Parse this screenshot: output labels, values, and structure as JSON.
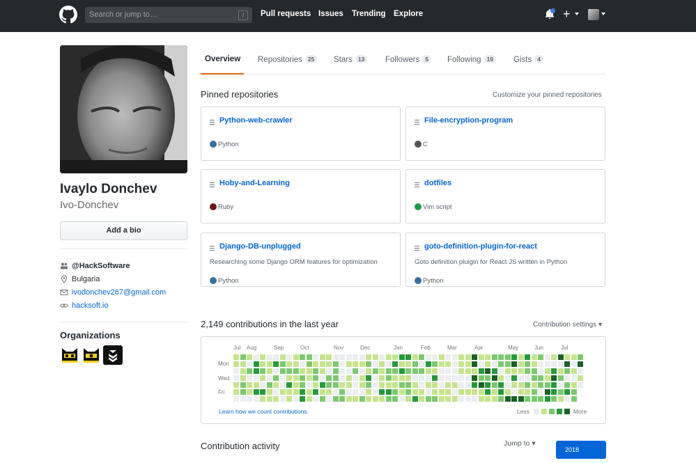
{
  "colors": {
    "header_bg": "#24292e",
    "link": "#0366d6",
    "tab_underline": "#e36209",
    "lang_python": "#3572A5",
    "lang_c": "#555555",
    "lang_ruby": "#701516",
    "lang_vim": "#199f4b",
    "contrib_levels": [
      "#ebedf0",
      "#c6e48b",
      "#7bc96f",
      "#239a3b",
      "#196127"
    ]
  },
  "header": {
    "logo_icon": "github-octocat-icon",
    "search_placeholder": "Search or jump to…",
    "search_shortcut": "/",
    "nav": [
      "Pull requests",
      "Issues",
      "Trending",
      "Explore"
    ],
    "notification_icon": "bell-icon",
    "create_icon": "plus-icon",
    "avatar_icon": "user-avatar-icon"
  },
  "profile": {
    "full_name": "Ivaylo Donchev",
    "username": "Ivo-Donchev",
    "add_bio_label": "Add a bio",
    "details": [
      {
        "icon": "organization-icon",
        "text": "@HackSoftware",
        "bold": true,
        "link": false
      },
      {
        "icon": "location-icon",
        "text": "Bulgaria",
        "bold": false,
        "link": false
      },
      {
        "icon": "mail-icon",
        "text": "ivodonchev267@gmail.com",
        "bold": false,
        "link": true
      },
      {
        "icon": "link-icon",
        "text": "hacksoft.io",
        "bold": false,
        "link": true
      }
    ],
    "organizations_title": "Organizations",
    "organizations": [
      "org-avatar-1",
      "org-avatar-2",
      "org-avatar-3"
    ]
  },
  "tabs": [
    {
      "label": "Overview",
      "count": null,
      "selected": true
    },
    {
      "label": "Repositories",
      "count": "25",
      "selected": false
    },
    {
      "label": "Stars",
      "count": "13",
      "selected": false
    },
    {
      "label": "Followers",
      "count": "5",
      "selected": false
    },
    {
      "label": "Following",
      "count": "19",
      "selected": false
    },
    {
      "label": "Gists",
      "count": "4",
      "selected": false
    }
  ],
  "pinned": {
    "title": "Pinned repositories",
    "customize_label": "Customize your pinned repositories",
    "repos": [
      {
        "name": "Python-web-crawler",
        "description": "",
        "language": "Python",
        "lang_color": "#3572A5"
      },
      {
        "name": "File-encryption-program",
        "description": "",
        "language": "C",
        "lang_color": "#555555"
      },
      {
        "name": "Hoby-and-Learning",
        "description": "",
        "language": "Ruby",
        "lang_color": "#701516"
      },
      {
        "name": "dotfiles",
        "description": "",
        "language": "Vim script",
        "lang_color": "#199f4b"
      },
      {
        "name": "Django-DB-unplugged",
        "description": "Researching some Django ORM features for optimization",
        "language": "Python",
        "lang_color": "#3572A5"
      },
      {
        "name": "goto-definition-plugin-for-react",
        "description": "Goto definition pluigin for React JS written in Python",
        "language": "Python",
        "lang_color": "#3572A5"
      }
    ]
  },
  "contributions": {
    "summary": "2,149 contributions in the last year",
    "settings_label": "Contribution settings",
    "months": [
      "Jul",
      "Aug",
      "Sep",
      "Oct",
      "Nov",
      "Dec",
      "Jan",
      "Feb",
      "Mar",
      "Apr",
      "May",
      "Jun",
      "Jul"
    ],
    "days": [
      "Mon",
      "Wed",
      "Fri"
    ],
    "learn_label": "Learn how we count contributions.",
    "legend_less": "Less",
    "legend_more": "More",
    "weeks": 53,
    "levels_seed": 7
  },
  "activity": {
    "title": "Contribution activity",
    "jump_label": "Jump to",
    "year": "2018"
  }
}
